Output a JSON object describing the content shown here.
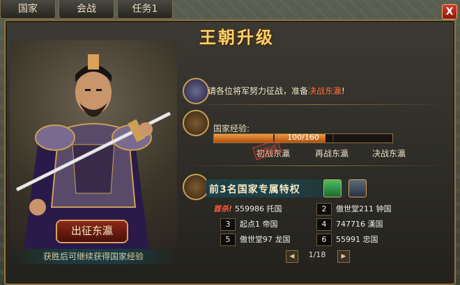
{
  "top_tabs": [
    "国家",
    "会战",
    "任务1"
  ],
  "close_label": "X",
  "title": "王朝升级",
  "call": {
    "prefix": "请各位将军努力征战，准备",
    "highlight": "决战东瀛",
    "suffix": "!"
  },
  "exp": {
    "label": "国家经验:",
    "value": "100/160",
    "progress": 0.625
  },
  "stages": [
    "初战东瀛",
    "再战东瀛",
    "决战东瀛"
  ],
  "stamp": "已完成",
  "privilege_title": "前3名国家专属特权",
  "rankings": [
    {
      "rank": "1",
      "name": "559986 托国",
      "first_tag": "首杀!"
    },
    {
      "rank": "2",
      "name": "傲世堂211 钟国"
    },
    {
      "rank": "3",
      "name": "起点1 帝国"
    },
    {
      "rank": "4",
      "name": "747716 漢国"
    },
    {
      "rank": "5",
      "name": "傲世堂97 龙国"
    },
    {
      "rank": "6",
      "name": "55991 忠国"
    }
  ],
  "pager": {
    "label": "1/18",
    "prev_icon": "◀",
    "next_icon": "▶"
  },
  "march_button": "出征东瀛",
  "footer_note": "获胜后可继续获得国家经验",
  "colors": {
    "gold": "#f7d36a",
    "highlight": "#ff6a3a",
    "frame": "#8b7444"
  }
}
